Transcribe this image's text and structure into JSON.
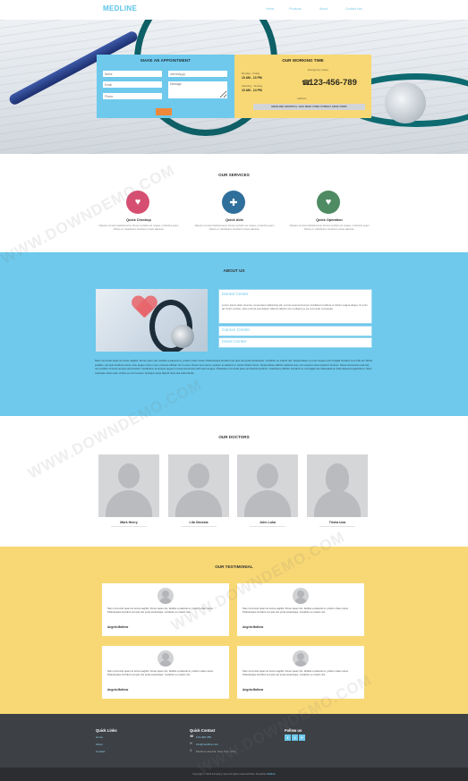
{
  "header": {
    "logo": "MEDLINE",
    "nav": [
      "Home",
      "Products",
      "About",
      "Contact Info"
    ]
  },
  "appointment": {
    "title": "MAKE AN APPOINTMENT",
    "name_placeholder": "Name",
    "date_placeholder": "mm/dd/yyyy",
    "email_placeholder": "Email",
    "message_placeholder": "Message",
    "phone_placeholder": "Phone"
  },
  "working_time": {
    "title": "OUR WORKING TIME",
    "rows": [
      {
        "label": "Monday - Friday",
        "value": "10 AM - 10 PM"
      },
      {
        "label": "Saturday - Sunday",
        "value": "10 AM - 14 PM"
      }
    ],
    "emergency_label": "Emergency Cases",
    "phone": "123-456-789",
    "address_label": "Address",
    "address": "MEDLINE HOSPITAL 1234 NEW YORK STREET, NEW YORK"
  },
  "services": {
    "title": "OUR SERVICES",
    "items": [
      {
        "name": "Quick Checkup",
        "text": "Aliquam sit amet facilisis lacus. Donec porttitor est massa, ut lobortis quam finibus et. Vestibulum hendrerit ornare placerat.",
        "color": "#d64f72",
        "icon": "stethoscope-icon"
      },
      {
        "name": "Quick Aids",
        "text": "Aliquam sit amet facilisis lacus. Donec porttitor est massa, ut lobortis quam finibus et. Vestibulum hendrerit ornare placerat.",
        "color": "#2f6f9c",
        "icon": "first-aid-icon"
      },
      {
        "name": "Quick Operation",
        "text": "Aliquam sit amet facilisis lacus. Donec porttitor est massa, ut lobortis quam finibus et. Vestibulum hendrerit ornare placerat.",
        "color": "#4e8a62",
        "icon": "heart-pulse-icon"
      }
    ]
  },
  "about": {
    "title": "ABOUT US",
    "accordion": [
      {
        "title": "Dental Center",
        "body": "Lorem ipsum dolor sit amet, consectetur adipiscing elit, sed do eiusmod tempor incididunt ut labore et dolore magna aliqua. Ut enim ad minim veniam, quis nostrud exercitation ullamco laboris nisi ut aliquip ex ea commodo consequat."
      },
      {
        "title": "Cancer Center"
      },
      {
        "title": "Heart Center"
      }
    ],
    "paragraph": "Nam commodo quam ac luctus sagittis. Donec quam dui, facilisis a placerat et, pretium vitae metus. Pellentesque tincidunt est quis nisi porta scelerisque. Curabitur eu mauris nisi. Suspendisse eu eros congue enim fringilla tincidunt et a nibh est. Morbi sodales, dui quis tincidunt luctus, ante augue rutrum eros, posuere efficitur orci in eros. Donec sem purus, pretium et eleifend ut, luctus finibus lorem. Suspendisse efficitur eleifend erat, nec tempus metus pulvinar sit amet. Donec accumsan erat nisl, nec porttitor sit amet tempus elit tincidunt. Vestibulum at semper augue in luctus accumsan nibh quis congue. Phasellus commodo justo vel lobortis tincidunt. Vestibulum efficitur tincidunt ex, id feugiat nisl malesuada at. Duis aliquet feugiat libero. Nunc vulputate varius ante, finibus eu orci tempus. Quisque turpis blandit risus sed velit lobortis."
  },
  "doctors": {
    "title": "OUR DOCTORS",
    "items": [
      {
        "name": "Mark Henry"
      },
      {
        "name": "Lila Okessia"
      },
      {
        "name": "John Luka"
      },
      {
        "name": "Trisha Izoa"
      }
    ]
  },
  "testimonials": {
    "title": "OUR TESTIMONIAL",
    "items": [
      {
        "text": "Nam commodo quam ac luctus sagittis. Donec quam dui, facilisis a placerat et, pretium vitae metus. Pellentesque tincidunt est quis nisi porta scelerisque. Curabitur eu mauris nisi.",
        "author": "Angela Mathew"
      },
      {
        "text": "Nam commodo quam ac luctus sagittis. Donec quam dui, facilisis a placerat et, pretium vitae metus. Pellentesque tincidunt est quis nisi porta scelerisque. Curabitur eu mauris nisi.",
        "author": "Angela Mathew"
      },
      {
        "text": "Nam commodo quam ac luctus sagittis. Donec quam dui, facilisis a placerat et, pretium vitae metus. Pellentesque tincidunt est quis nisi porta scelerisque. Curabitur eu mauris nisi.",
        "author": "Angela Mathew"
      },
      {
        "text": "Nam commodo quam ac luctus sagittis. Donec quam dui, facilisis a placerat et, pretium vitae metus. Pellentesque tincidunt est quis nisi porta scelerisque. Curabitur eu mauris nisi.",
        "author": "Angela Mathew"
      }
    ]
  },
  "footer": {
    "quick_links_title": "Quick Links",
    "links": [
      "Home",
      "About",
      "Contact"
    ],
    "contact_title": "Quick Contact",
    "contact": [
      "123-456-789",
      "info@medline.com",
      "Medline Hospital, New York, USA"
    ],
    "follow_title": "Follow us",
    "social": [
      "f",
      "t",
      "g+"
    ],
    "copyright": "Copyright © 2022 Company name All rights reserved More Templates",
    "copyright_link": "Medline"
  },
  "watermark": "WWW.DOWNDEMO.COM",
  "colors": {
    "accent_blue": "#6ec9ec",
    "accent_yellow": "#f8d874",
    "submit_orange": "#f0883a",
    "footer_dark": "#3d4044"
  }
}
